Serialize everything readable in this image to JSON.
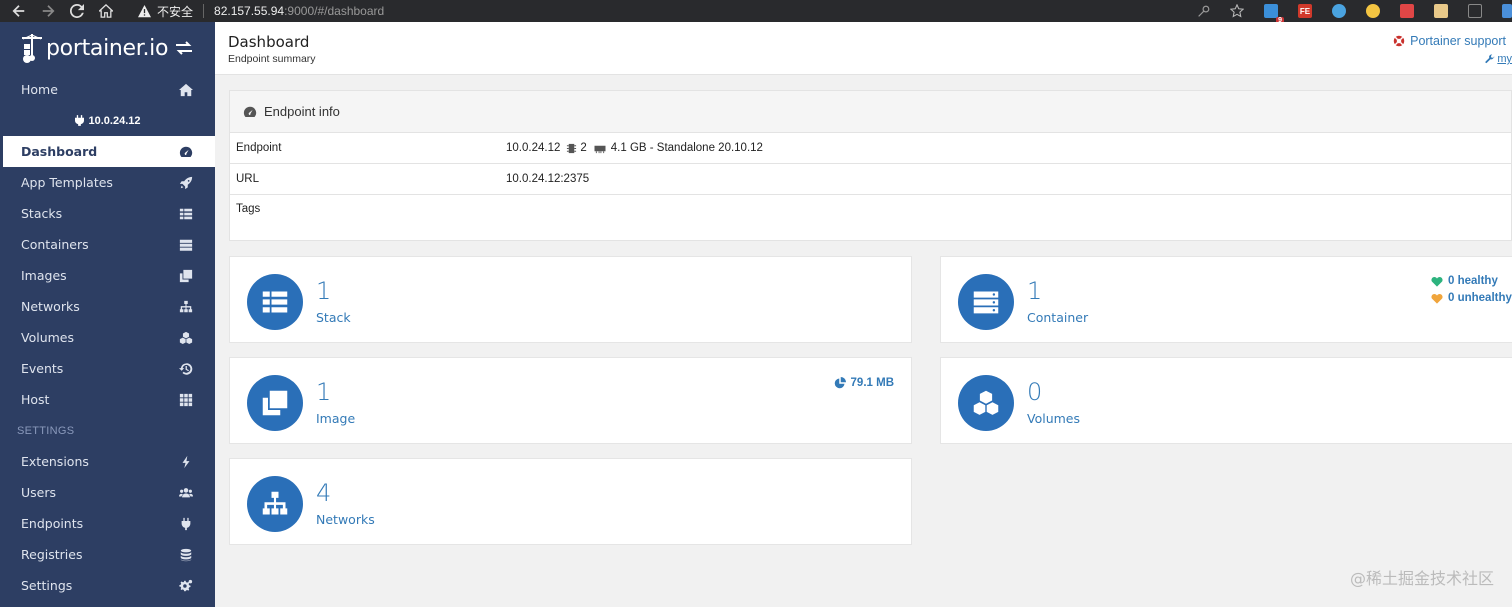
{
  "browser": {
    "security_label": "不安全",
    "url_host": "82.157.55.94",
    "url_path": ":9000/#/dashboard",
    "extension_badge": "9",
    "extension_fe": "FE"
  },
  "sidebar": {
    "brand": "portainer.io",
    "home_label": "Home",
    "endpoint_name": "10.0.24.12",
    "items": [
      {
        "label": "Dashboard",
        "icon": "tachometer-icon"
      },
      {
        "label": "App Templates",
        "icon": "rocket-icon"
      },
      {
        "label": "Stacks",
        "icon": "th-list-icon"
      },
      {
        "label": "Containers",
        "icon": "server-icon"
      },
      {
        "label": "Images",
        "icon": "clone-icon"
      },
      {
        "label": "Networks",
        "icon": "sitemap-icon"
      },
      {
        "label": "Volumes",
        "icon": "cubes-icon"
      },
      {
        "label": "Events",
        "icon": "history-icon"
      },
      {
        "label": "Host",
        "icon": "th-icon"
      }
    ],
    "settings_heading": "SETTINGS",
    "settings_items": [
      {
        "label": "Extensions",
        "icon": "bolt-icon"
      },
      {
        "label": "Users",
        "icon": "users-icon"
      },
      {
        "label": "Endpoints",
        "icon": "plug-icon"
      },
      {
        "label": "Registries",
        "icon": "database-icon"
      },
      {
        "label": "Settings",
        "icon": "cogs-icon"
      }
    ]
  },
  "header": {
    "title": "Dashboard",
    "subtitle": "Endpoint summary",
    "support_label": "Portainer support",
    "my_account_label": "my"
  },
  "endpoint_info": {
    "title": "Endpoint info",
    "rows": [
      {
        "key": "Endpoint",
        "value": "10.0.24.12",
        "cpu": "2",
        "memory": "4.1 GB - Standalone 20.10.12"
      },
      {
        "key": "URL",
        "value": "10.0.24.12:2375"
      },
      {
        "key": "Tags",
        "value": ""
      }
    ]
  },
  "stats": {
    "stack": {
      "count": "1",
      "label": "Stack"
    },
    "container": {
      "count": "1",
      "label": "Container",
      "healthy": "0 healthy",
      "unhealthy": "0 unhealthy"
    },
    "image": {
      "count": "1",
      "label": "Image",
      "size": "79.1 MB"
    },
    "volumes": {
      "count": "0",
      "label": "Volumes"
    },
    "networks": {
      "count": "4",
      "label": "Networks"
    }
  },
  "colors": {
    "sidebar_bg": "#2d3e63",
    "accent": "#337ab7",
    "icon_circle": "#2a6fb8",
    "healthy": "#2db37e",
    "unhealthy": "#f0a53c"
  },
  "watermark": "@稀土掘金技术社区"
}
